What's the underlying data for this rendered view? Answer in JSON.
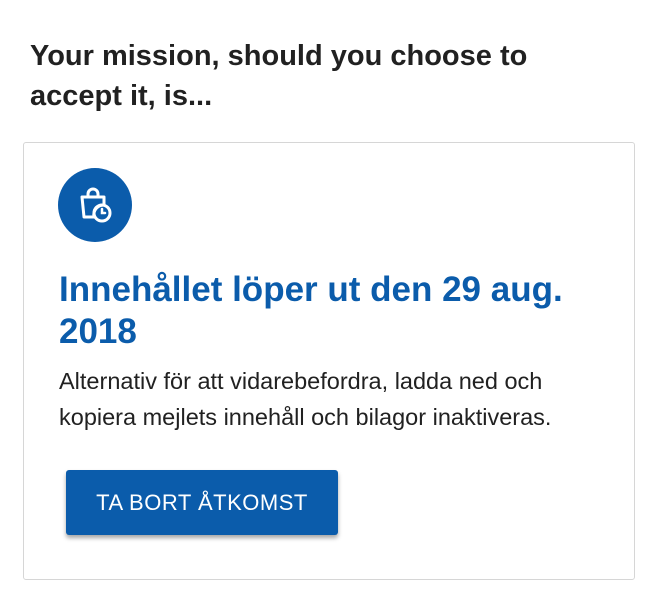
{
  "heading": "Your mission, should you choose to accept it, is...",
  "card": {
    "icon": "bag-clock-icon",
    "title": "Innehållet löper ut den 29 aug. 2018",
    "description": "Alternativ för att vidarebefordra, ladda ned och kopiera mejlets innehåll och bilagor inaktiveras.",
    "button_label": "TA BORT ÅTKOMST"
  },
  "colors": {
    "accent": "#0b5cab",
    "text": "#212121",
    "card_border": "#d6d6d6",
    "background": "#ffffff"
  }
}
